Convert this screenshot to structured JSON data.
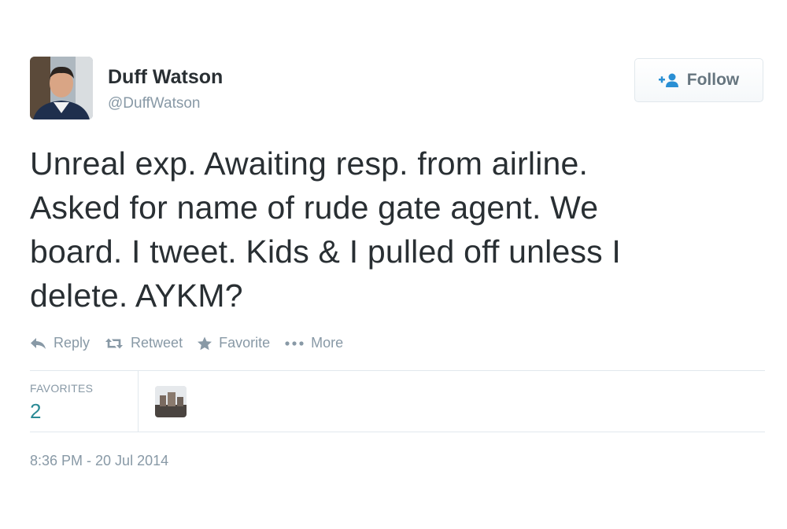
{
  "user": {
    "display_name": "Duff Watson",
    "screen_name": "@DuffWatson",
    "avatar_icon": "profile-photo"
  },
  "follow_button": {
    "label": "Follow",
    "icon": "add-user-icon",
    "color": "#66757f"
  },
  "tweet": {
    "text": "Unreal exp. Awaiting resp. from airline.\nAsked for name of rude gate agent. We\nboard. I tweet. Kids & I pulled off unless I\ndelete. AYKM?"
  },
  "actions": [
    {
      "label": "Reply",
      "icon": "reply-icon"
    },
    {
      "label": "Retweet",
      "icon": "retweet-icon"
    },
    {
      "label": "Favorite",
      "icon": "star-icon"
    },
    {
      "label": "More",
      "icon": "more-dots-icon"
    }
  ],
  "stats": {
    "favorites_label": "FAVORITES",
    "favorites_count": "2",
    "count_color": "#2a8a95"
  },
  "timestamp": "8:36 PM - 20 Jul 2014",
  "colors": {
    "text": "#292f33",
    "muted": "#8899a6",
    "divider": "#e1e8ed"
  }
}
